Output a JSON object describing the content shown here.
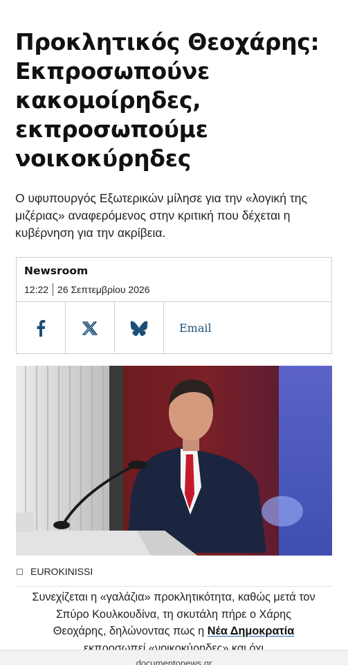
{
  "article": {
    "headline": "Προκλητικός Θεοχάρης: Εκπροσωπούνε κακομοίρηδες, εκπροσωπούμε νοικοκύρηδες",
    "lead": "Ο υφυπουργός Εξωτερικών μίλησε για την «λογική της μιζέριας» αναφερόμενος στην κριτική που δέχεται η κυβέρνηση για την ακρίβεια."
  },
  "meta": {
    "author": "Newsroom",
    "time": "12:22",
    "date": "26 Σεπτεμβρίου 2026"
  },
  "share": {
    "facebook_icon": "facebook-icon",
    "x_icon": "x-icon",
    "bluesky_icon": "bluesky-icon",
    "email_label": "Email"
  },
  "photo": {
    "credit": "EUROKINISSI"
  },
  "body": {
    "text_before": "Συνεχίζεται η «γαλάζια» προκλητικότητα, καθώς μετά τον Σπύρο Κουλκουδίνα, τη σκυτάλη πήρε ο Χάρης Θεοχάρης, δηλώνοντας πως η ",
    "link": "Νέα Δημοκρατία",
    "text_after": " εκπροσωπεί «νοικοκύρηδες» και όχι"
  },
  "footer": {
    "url": "documentonews.gr"
  },
  "colors": {
    "brand_blue": "#1c4f78",
    "link_underline": "#2a63c6"
  }
}
